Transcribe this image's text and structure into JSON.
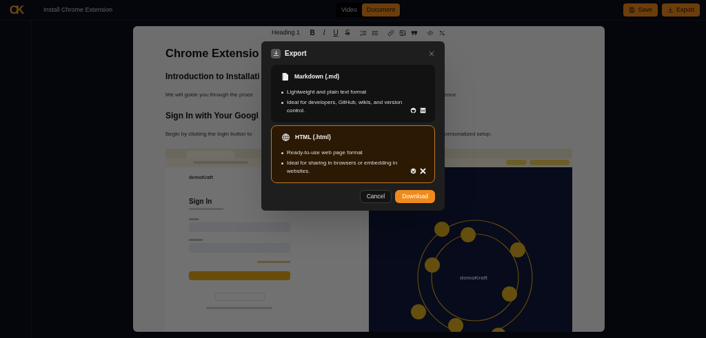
{
  "topbar": {
    "logo": "CK",
    "title": "Install Chrome Extension",
    "view_toggle": [
      {
        "label": "Video",
        "selected": false
      },
      {
        "label": "Document",
        "selected": true
      }
    ],
    "actions": [
      {
        "kind": "save",
        "label": "Save"
      },
      {
        "kind": "export",
        "label": "Export"
      }
    ]
  },
  "editor_toolbar": [
    {
      "kind": "dropdown",
      "label": "Heading 1"
    },
    {
      "kind": "bold",
      "label": "B"
    },
    {
      "kind": "italic",
      "label": "I"
    },
    {
      "kind": "underline",
      "label": "U"
    },
    {
      "kind": "strike",
      "label": "S"
    },
    {
      "kind": "ordered-list"
    },
    {
      "kind": "bullet-list"
    },
    {
      "kind": "link"
    },
    {
      "kind": "image"
    },
    {
      "kind": "quote"
    },
    {
      "kind": "code"
    },
    {
      "kind": "clear-format"
    }
  ],
  "document": {
    "blocks": [
      {
        "kind": "h1",
        "left": "Chrome Extensio"
      },
      {
        "kind": "h2",
        "left": "Introduction to Installati"
      },
      {
        "kind": "p",
        "left": "We will guide you through the proce",
        "right": "ence."
      },
      {
        "kind": "h2",
        "left": "Sign In with Your Googl"
      },
      {
        "kind": "p",
        "left": "Begin by clicking the login button to",
        "right": "personalized setup."
      }
    ],
    "embedded_screenshot": {
      "brand": "demoKraft",
      "heading": "Sign In",
      "hero_brand": "demoKraft"
    }
  },
  "dialog": {
    "title": "Export",
    "options": [
      {
        "kind": "markdown",
        "title": "Markdown (.md)",
        "selected": false,
        "bullets": [
          "Lightweight and plain text format",
          "Ideal for developers, GitHub, wikis, and version control."
        ]
      },
      {
        "kind": "html",
        "title": "HTML (.html)",
        "selected": true,
        "bullets": [
          "Ready-to-use web page format",
          "Ideal for sharing in browsers or embedding in websites."
        ]
      }
    ],
    "buttons": [
      {
        "kind": "secondary",
        "label": "Cancel"
      },
      {
        "kind": "primary",
        "label": "Download"
      }
    ]
  }
}
